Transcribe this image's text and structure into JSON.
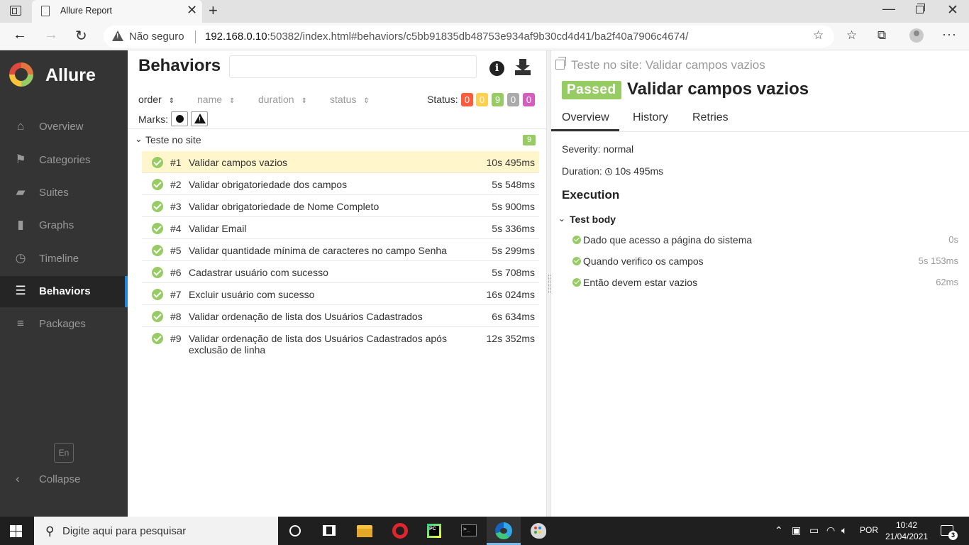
{
  "browser": {
    "tab_title": "Allure Report",
    "not_secure": "Não seguro",
    "url_host": "192.168.0.10",
    "url_rest": ":50382/index.html#behaviors/c5bb91835db48753e934af9b30cd4d41/ba2f40a7906c4674/"
  },
  "sidebar": {
    "brand": "Allure",
    "items": [
      {
        "label": "Overview",
        "icon": "home-icon"
      },
      {
        "label": "Categories",
        "icon": "flag-icon"
      },
      {
        "label": "Suites",
        "icon": "briefcase-icon"
      },
      {
        "label": "Graphs",
        "icon": "bar-chart-icon"
      },
      {
        "label": "Timeline",
        "icon": "clock-icon"
      },
      {
        "label": "Behaviors",
        "icon": "list-icon",
        "active": true
      },
      {
        "label": "Packages",
        "icon": "align-left-icon"
      }
    ],
    "language": "En",
    "collapse": "Collapse"
  },
  "tree": {
    "title": "Behaviors",
    "search_value": "",
    "sort": {
      "order": "order",
      "name": "name",
      "duration": "duration",
      "status": "status"
    },
    "status_label": "Status:",
    "status_counts": [
      {
        "value": "0",
        "color": "#fd5a3e"
      },
      {
        "value": "0",
        "color": "#ffd050"
      },
      {
        "value": "9",
        "color": "#97cc64"
      },
      {
        "value": "0",
        "color": "#aaaaaa"
      },
      {
        "value": "0",
        "color": "#d35ebe"
      }
    ],
    "marks_label": "Marks:",
    "group": {
      "name": "Teste no site",
      "count": "9"
    },
    "rows": [
      {
        "num": "#1",
        "name": "Validar campos vazios",
        "dur": "10s 495ms"
      },
      {
        "num": "#2",
        "name": "Validar obrigatoriedade dos campos",
        "dur": "5s 548ms"
      },
      {
        "num": "#3",
        "name": "Validar obrigatoriedade de Nome Completo",
        "dur": "5s 900ms"
      },
      {
        "num": "#4",
        "name": "Validar Email",
        "dur": "5s 336ms"
      },
      {
        "num": "#5",
        "name": "Validar quantidade mínima de caracteres no campo Senha",
        "dur": "5s 299ms"
      },
      {
        "num": "#6",
        "name": "Cadastrar usuário com sucesso",
        "dur": "5s 708ms"
      },
      {
        "num": "#7",
        "name": "Excluir usuário com sucesso",
        "dur": "16s 024ms"
      },
      {
        "num": "#8",
        "name": "Validar ordenação de lista dos Usuários Cadastrados",
        "dur": "6s 634ms"
      },
      {
        "num": "#9",
        "name": "Validar ordenação de lista dos Usuários Cadastrados após exclusão de linha",
        "dur": "12s 352ms"
      }
    ]
  },
  "detail": {
    "breadcrumb": "Teste no site: Validar campos vazios",
    "status": "Passed",
    "title": "Validar campos vazios",
    "tabs": [
      "Overview",
      "History",
      "Retries"
    ],
    "severity": "Severity: normal",
    "duration_label": "Duration:",
    "duration": "10s 495ms",
    "execution": "Execution",
    "test_body": "Test body",
    "steps": [
      {
        "name": "Dado que acesso a página do sistema",
        "dur": "0s"
      },
      {
        "name": "Quando verifico os campos",
        "dur": "5s 153ms"
      },
      {
        "name": "Então devem estar vazios",
        "dur": "62ms"
      }
    ]
  },
  "taskbar": {
    "search_placeholder": "Digite aqui para pesquisar",
    "language": "POR",
    "time": "10:42",
    "date": "21/04/2021",
    "notifications": "3"
  }
}
